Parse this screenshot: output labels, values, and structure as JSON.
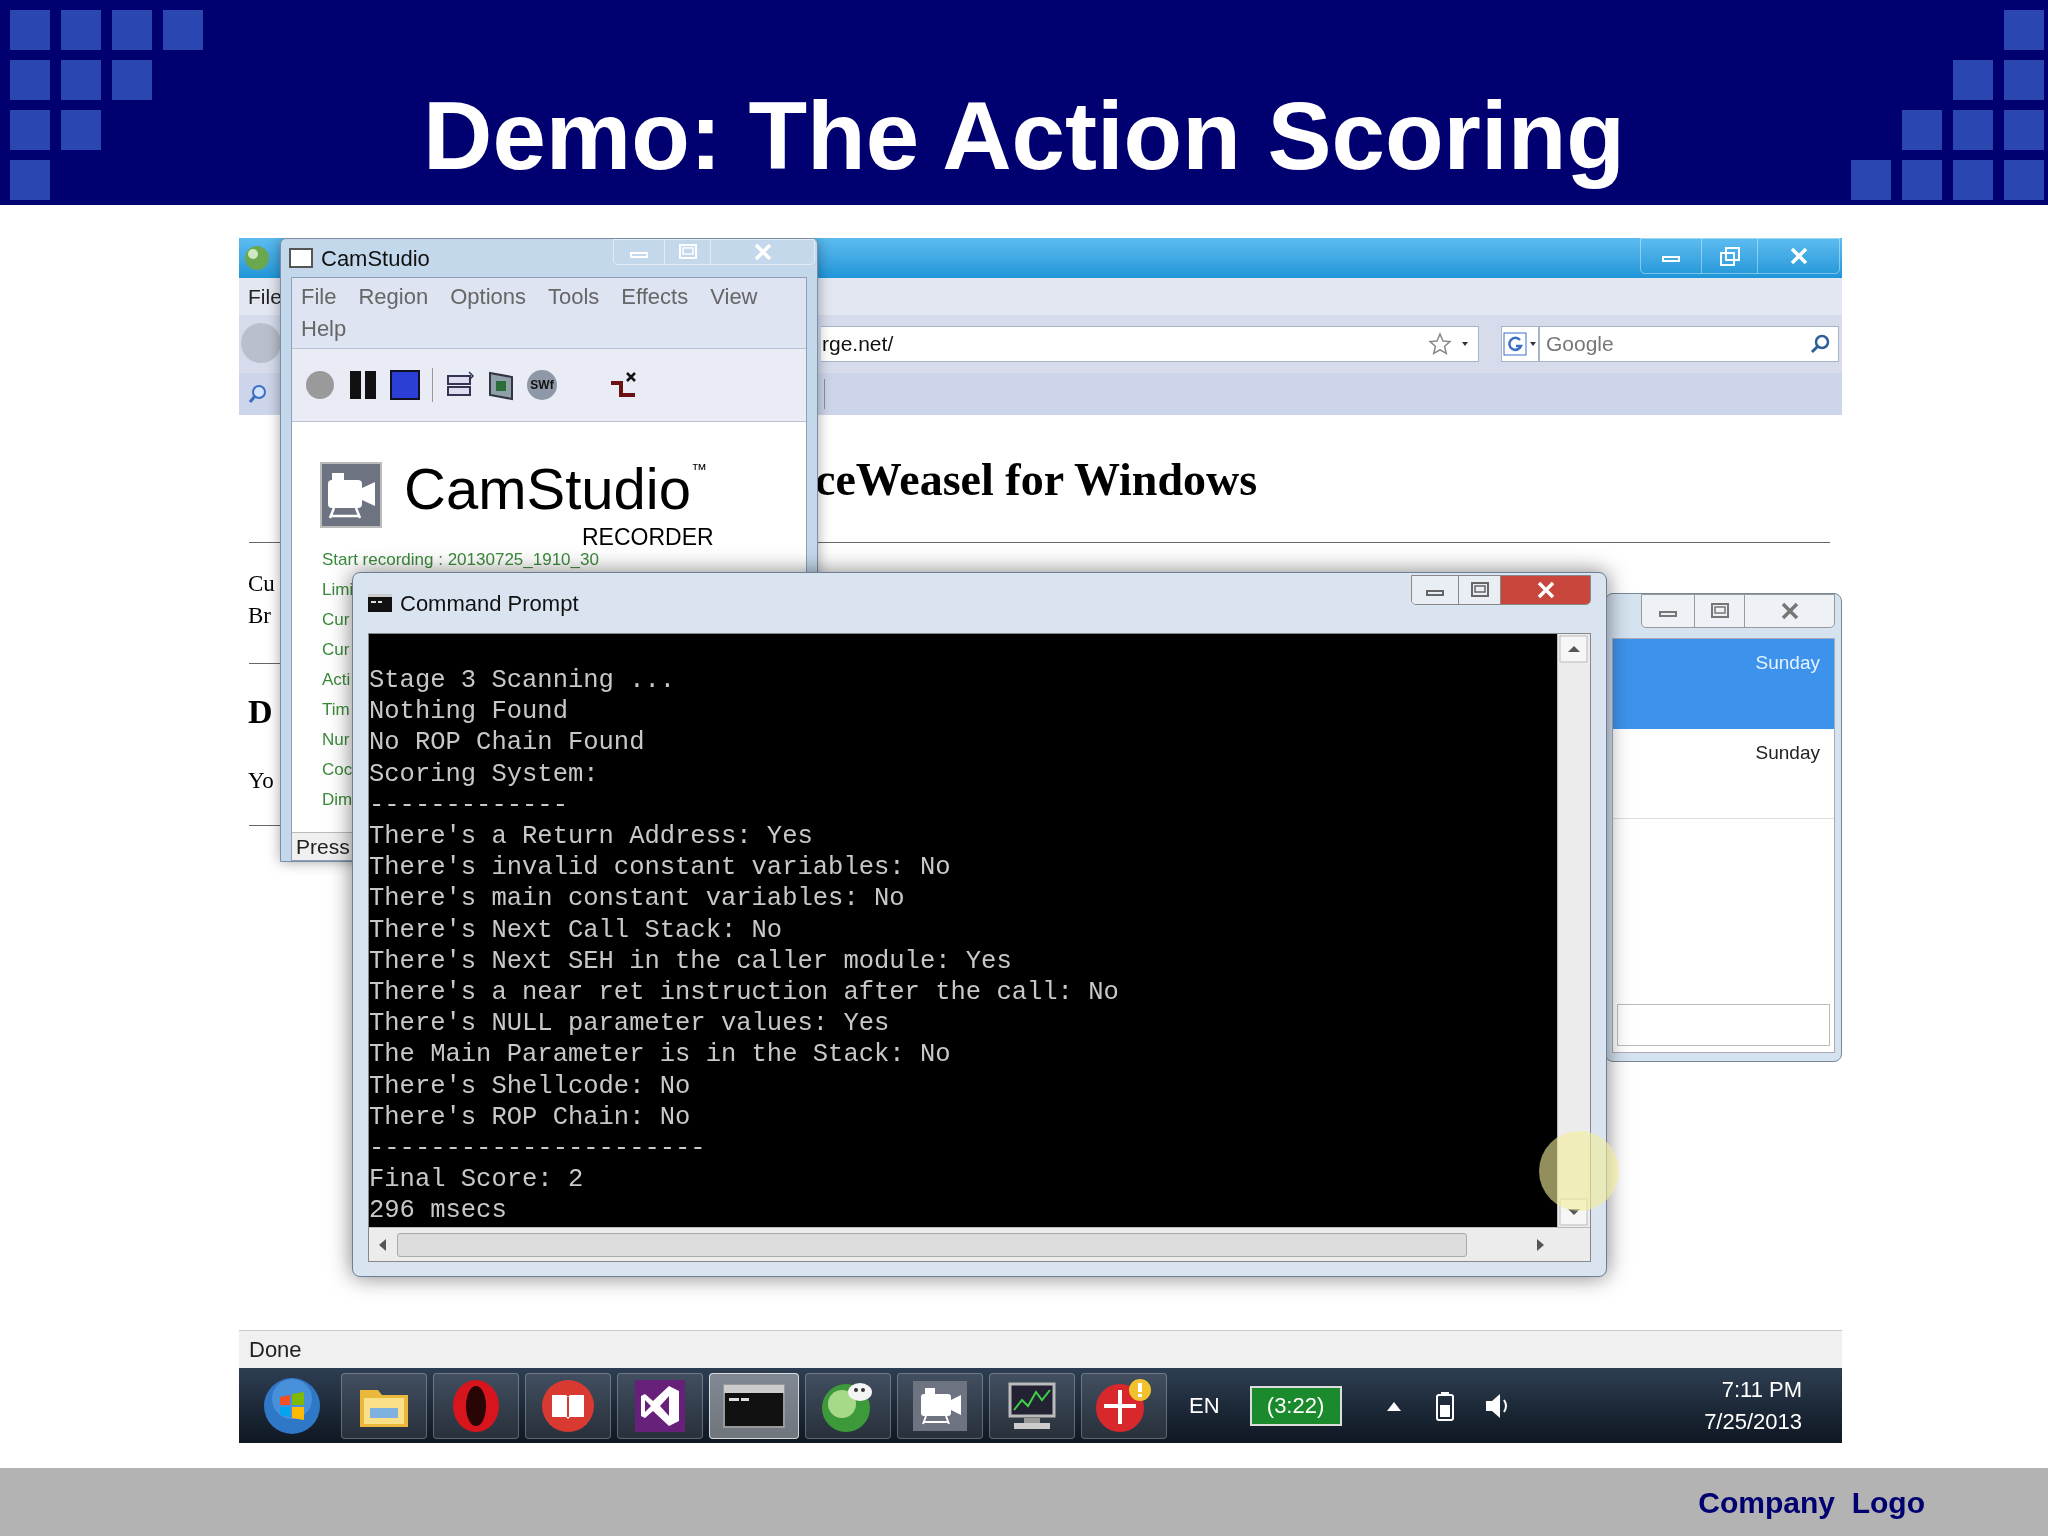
{
  "slide": {
    "title": "Demo: The Action Scoring",
    "footer": "Company  Logo"
  },
  "browser": {
    "menu": [
      "File"
    ],
    "address": "rge.net/",
    "search": {
      "placeholder": "Google"
    },
    "heading": "ceWeasel for Windows",
    "fragments": [
      {
        "kind": "line",
        "text": "Cu"
      },
      {
        "kind": "line",
        "text": "Br"
      },
      {
        "kind": "heading",
        "text": "D"
      },
      {
        "kind": "line",
        "text": "Yo"
      }
    ],
    "status": "Done"
  },
  "camstudio": {
    "title": "CamStudio",
    "menu": [
      "File",
      "Region",
      "Options",
      "Tools",
      "Effects",
      "View",
      "Help"
    ],
    "toolbar": [
      {
        "kind": "record"
      },
      {
        "kind": "pause"
      },
      {
        "kind": "stop"
      },
      {
        "kind": "separator"
      },
      {
        "kind": "region"
      },
      {
        "kind": "film"
      },
      {
        "kind": "swf",
        "label": "SWf"
      },
      {
        "kind": "autopan"
      }
    ],
    "logo": {
      "name": "CamStudio",
      "mark": "™",
      "subtitle": "RECORDER"
    },
    "status_line": "Start recording : 20130725_1910_30",
    "info": [
      "Limi",
      "Cur",
      "Cur",
      "Acti",
      "Tim",
      "Nur",
      "Coc",
      "Dim"
    ],
    "status_bar": "Press"
  },
  "calendar_window": {
    "rows": [
      {
        "label": "Sunday",
        "selected": true
      },
      {
        "label": "Sunday",
        "selected": false
      }
    ]
  },
  "console": {
    "title": "Command Prompt",
    "lines": [
      "Stage 3 Scanning ...",
      "Nothing Found",
      "No ROP Chain Found",
      "Scoring System:",
      "-------------",
      "There's a Return Address: Yes",
      "There's invalid constant variables: No",
      "There's main constant variables: No",
      "There's Next Call Stack: No",
      "There's Next SEH in the caller module: Yes",
      "There's a near ret instruction after the call: No",
      "There's NULL parameter values: Yes",
      "The Main Parameter is in the Stack: No",
      "There's Shellcode: No",
      "There's ROP Chain: No",
      "----------------------",
      "Final Score: 2",
      "296 msecs"
    ]
  },
  "taskbar": {
    "apps": [
      {
        "kind": "start",
        "active": false
      },
      {
        "kind": "folder",
        "active": false
      },
      {
        "kind": "opera",
        "active": false
      },
      {
        "kind": "book",
        "active": false
      },
      {
        "kind": "vs",
        "active": false
      },
      {
        "kind": "terminal",
        "active": true
      },
      {
        "kind": "globe",
        "active": false
      },
      {
        "kind": "camera",
        "active": false
      },
      {
        "kind": "monitor",
        "active": false
      },
      {
        "kind": "alert",
        "active": false
      }
    ],
    "language": "EN",
    "battery_time": "(3:22)",
    "time": "7:11 PM",
    "date": "7/25/2013"
  }
}
